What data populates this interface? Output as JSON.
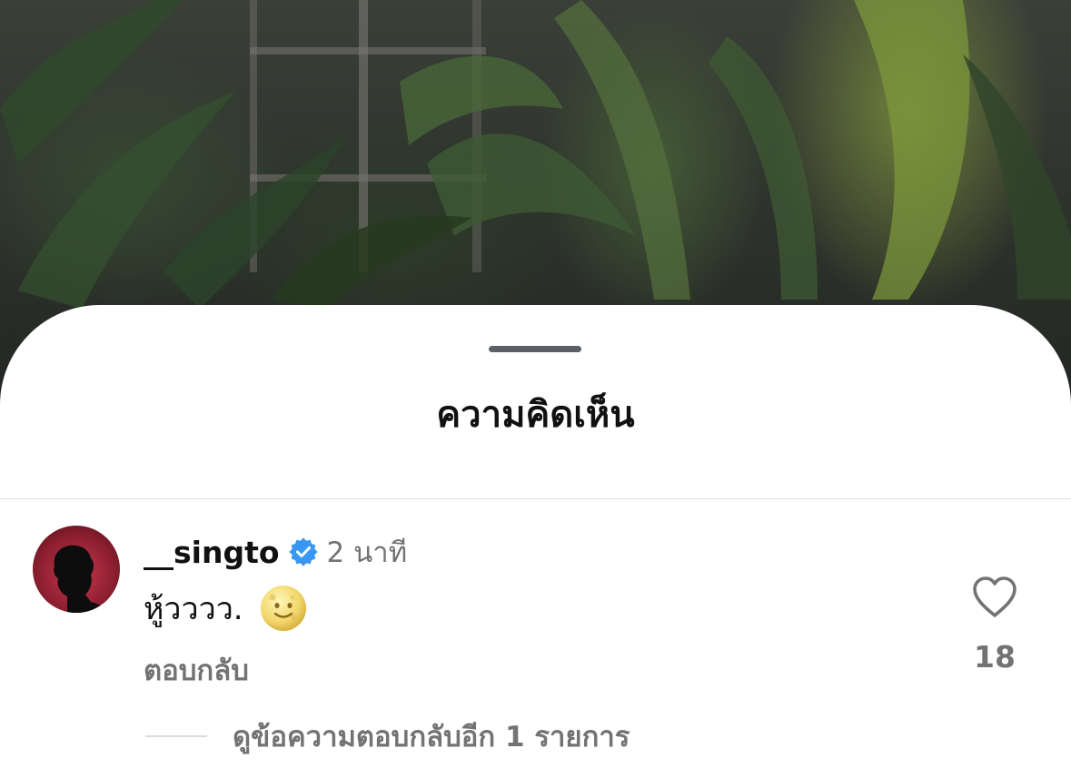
{
  "sheet": {
    "title": "ความคิดเห็น"
  },
  "comment": {
    "username": "__singto",
    "verified": true,
    "timestamp": "2 นาที",
    "text": "หู้วววว.",
    "emoji_icon": "full-moon-face-icon",
    "reply_label": "ตอบกลับ",
    "like_count": "18",
    "view_replies_label": "ดูข้อความตอบกลับอีก 1 รายการ"
  },
  "colors": {
    "verified_blue": "#3897f0",
    "secondary_text": "#737373",
    "primary_text": "#111111",
    "avatar_red": "#b0283c"
  }
}
